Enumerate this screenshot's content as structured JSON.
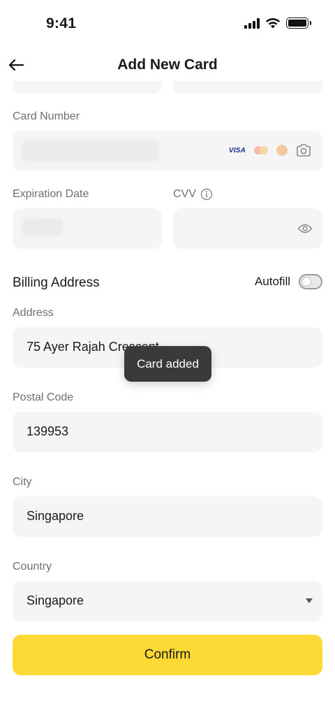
{
  "status_bar": {
    "time": "9:41"
  },
  "header": {
    "title": "Add New Card"
  },
  "card_number": {
    "label": "Card Number",
    "card_brand": "VISA"
  },
  "expiration": {
    "label": "Expiration Date"
  },
  "cvv": {
    "label": "CVV"
  },
  "billing": {
    "title": "Billing Address",
    "autofill_label": "Autofill",
    "autofill_on": false
  },
  "address": {
    "label": "Address",
    "value": "75 Ayer Rajah Crescent"
  },
  "postal_code": {
    "label": "Postal Code",
    "value": "139953"
  },
  "city": {
    "label": "City",
    "value": "Singapore"
  },
  "country": {
    "label": "Country",
    "value": "Singapore"
  },
  "confirm_button": {
    "label": "Confirm"
  },
  "toast": {
    "message": "Card added"
  },
  "colors": {
    "accent": "#fcd935",
    "field_bg": "#f5f5f5",
    "toast_bg": "#3a3a3a"
  }
}
